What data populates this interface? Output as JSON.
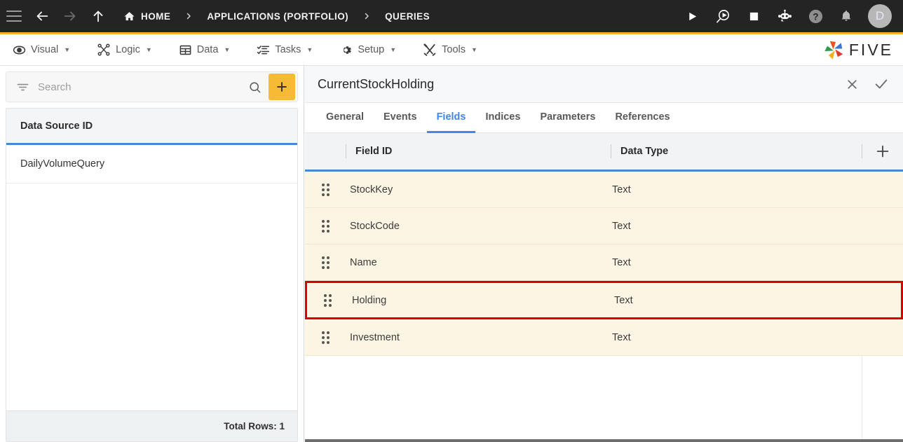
{
  "topbar": {
    "icons": {
      "menu": "hamburger-icon",
      "back": "back-arrow-icon",
      "forward": "forward-arrow-icon",
      "up": "up-arrow-icon"
    },
    "breadcrumb": [
      {
        "label": "HOME",
        "icon": "home-icon"
      },
      {
        "label": "APPLICATIONS (PORTFOLIO)",
        "icon": ""
      },
      {
        "label": "QUERIES",
        "icon": ""
      }
    ],
    "actions": [
      {
        "name": "run-button",
        "icon": "play-icon"
      },
      {
        "name": "debug-button",
        "icon": "play-magnifier-icon"
      },
      {
        "name": "stop-button",
        "icon": "stop-square-icon"
      },
      {
        "name": "assistant-button",
        "icon": "robot-icon"
      },
      {
        "name": "help-button",
        "icon": "question-circle-icon"
      },
      {
        "name": "notifications-button",
        "icon": "bell-icon"
      }
    ],
    "avatar_initial": "D"
  },
  "menubar": {
    "items": [
      {
        "label": "Visual",
        "icon": "eye-icon"
      },
      {
        "label": "Logic",
        "icon": "nodes-icon"
      },
      {
        "label": "Data",
        "icon": "table-icon"
      },
      {
        "label": "Tasks",
        "icon": "checklist-icon"
      },
      {
        "label": "Setup",
        "icon": "gear-icon"
      },
      {
        "label": "Tools",
        "icon": "tools-icon"
      }
    ],
    "caret": "▼",
    "brand": "FIVE"
  },
  "left_panel": {
    "search": {
      "placeholder": "Search",
      "value": "",
      "filter_icon": "filter-icon",
      "search_icon": "magnifier-icon",
      "add_label": "+"
    },
    "table": {
      "column_header": "Data Source ID",
      "rows": [
        "DailyVolumeQuery"
      ]
    },
    "footer": "Total Rows: 1"
  },
  "right_panel": {
    "title": "CurrentStockHolding",
    "actions": [
      {
        "name": "close-button",
        "icon": "close-icon"
      },
      {
        "name": "confirm-button",
        "icon": "check-icon"
      }
    ],
    "tabs": [
      {
        "label": "General",
        "active": false
      },
      {
        "label": "Events",
        "active": false
      },
      {
        "label": "Fields",
        "active": true
      },
      {
        "label": "Indices",
        "active": false
      },
      {
        "label": "Parameters",
        "active": false
      },
      {
        "label": "References",
        "active": false
      }
    ],
    "grid": {
      "columns": [
        "Field ID",
        "Data Type"
      ],
      "add_column_label": "+",
      "rows": [
        {
          "field_id": "StockKey",
          "data_type": "Text",
          "highlighted": false
        },
        {
          "field_id": "StockCode",
          "data_type": "Text",
          "highlighted": false
        },
        {
          "field_id": "Name",
          "data_type": "Text",
          "highlighted": false
        },
        {
          "field_id": "Holding",
          "data_type": "Text",
          "highlighted": true
        },
        {
          "field_id": "Investment",
          "data_type": "Text",
          "highlighted": false
        }
      ]
    }
  },
  "colors": {
    "accent_yellow": "#f5b323",
    "accent_blue": "#4287e6",
    "grid_header_underline": "#4a86d8",
    "row_background": "#fdf5e3",
    "highlight_border": "#d90000",
    "topbar_background": "#242424"
  }
}
